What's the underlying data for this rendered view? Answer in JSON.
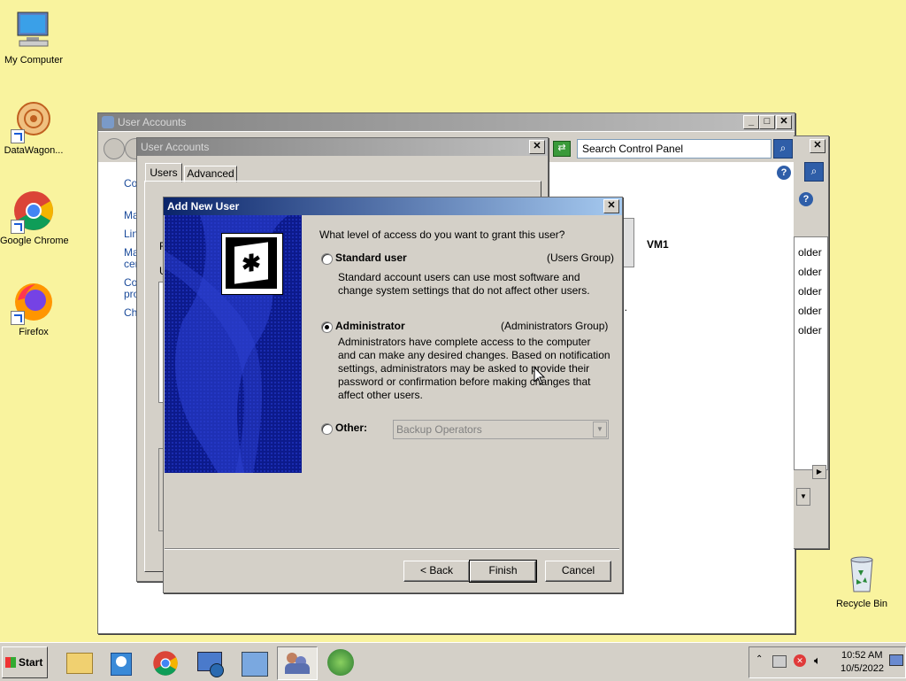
{
  "desktop": {
    "icons": [
      {
        "label": "My Computer",
        "icon": "my-computer-icon"
      },
      {
        "label": "DataWagon...",
        "icon": "datawagon-icon"
      },
      {
        "label": "Google Chrome",
        "icon": "chrome-icon"
      },
      {
        "label": "Firefox",
        "icon": "firefox-icon"
      },
      {
        "label": "Recycle Bin",
        "icon": "recycle-bin-icon"
      }
    ]
  },
  "back_window": {
    "title": "User Accounts",
    "search_placeholder": "Search Control Panel",
    "links_partial": [
      "Cor",
      "Ma",
      "Lin",
      "Ma",
      "cer",
      "Co",
      "pro",
      "Cha"
    ],
    "right_panel": {
      "vm_label": "VM1",
      "folder_items": [
        "older",
        "older",
        "older",
        "older",
        "older"
      ],
      "stray_text": "l."
    }
  },
  "mid_window": {
    "title": "User Accounts",
    "tabs": [
      "Users",
      "Advanced"
    ],
    "active_tab": "Users",
    "partial_labels": [
      "F",
      "U"
    ]
  },
  "dialog": {
    "title": "Add New User",
    "question": "What level of access do you want to grant this user?",
    "options": [
      {
        "label": "Standard user",
        "group": "(Users Group)",
        "selected": false,
        "desc": [
          "Standard account users can use most software and",
          "change system settings that do not affect other users."
        ]
      },
      {
        "label": "Administrator",
        "group": "(Administrators Group)",
        "selected": true,
        "desc": [
          "Administrators have complete access to the computer",
          "and can make any desired changes. Based on notification",
          "settings, administrators may be asked to provide their",
          "password or confirmation before making changes that",
          "affect other users."
        ]
      },
      {
        "label": "Other:",
        "selected": false,
        "select_value": "Backup Operators"
      }
    ],
    "buttons": {
      "back": "< Back",
      "finish": "Finish",
      "cancel": "Cancel"
    }
  },
  "taskbar": {
    "start_label": "Start",
    "apps": [
      "file-explorer-icon",
      "media-player-icon",
      "chrome-icon",
      "network-computer-icon",
      "control-panel-icon",
      "user-accounts-icon",
      "windows-orb-icon"
    ],
    "active_app": "user-accounts-icon",
    "clock_time": "10:52 AM",
    "clock_date": "10/5/2022",
    "tray": [
      "show-hidden-icon",
      "network-icon",
      "security-alert-icon",
      "volume-icon"
    ]
  },
  "colors": {
    "desktop": "#f9f39e",
    "active_title": "#0a246a",
    "dialog_banner": "#0c1a8c"
  }
}
